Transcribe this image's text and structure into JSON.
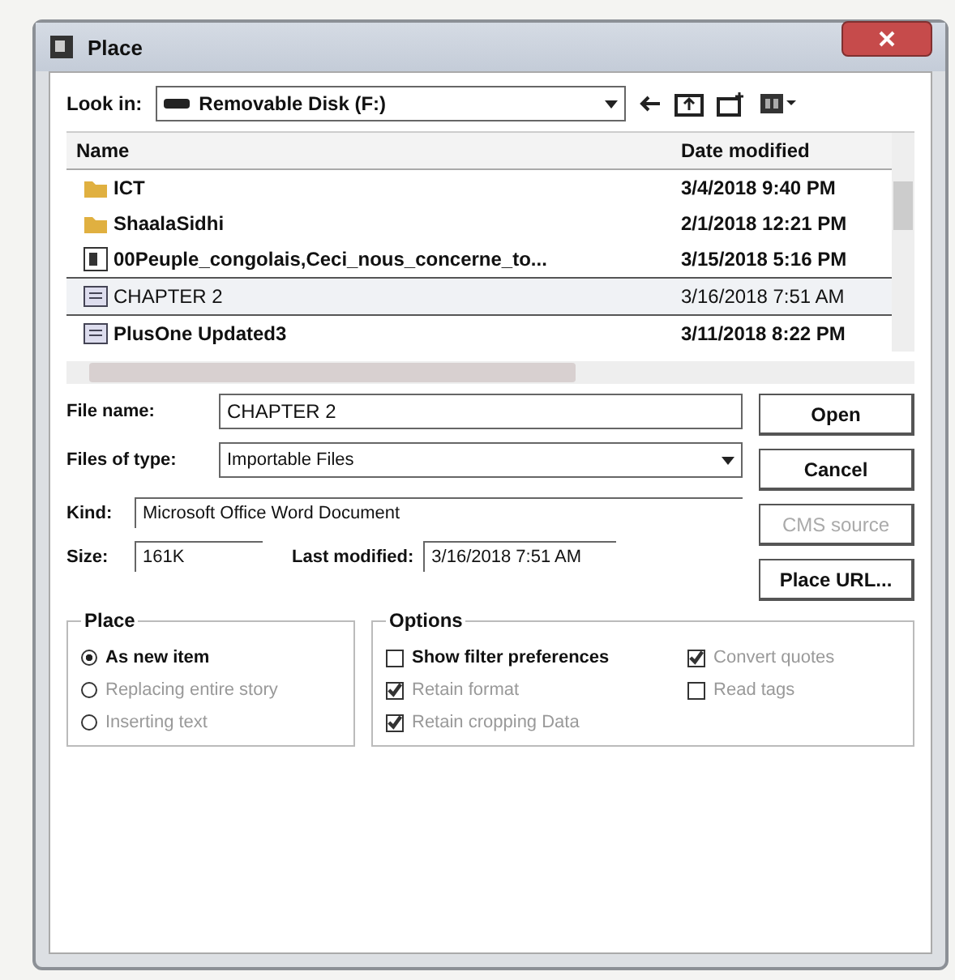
{
  "window": {
    "title": "Place"
  },
  "look_in": {
    "label": "Look in:",
    "value": "Removable Disk (F:)"
  },
  "file_list": {
    "columns": [
      "Name",
      "Date modified"
    ],
    "rows": [
      {
        "kind": "folder",
        "name": "ICT",
        "date": "3/4/2018 9:40 PM",
        "selected": false
      },
      {
        "kind": "folder",
        "name": "ShaalaSidhi",
        "date": "2/1/2018 12:21 PM",
        "selected": false
      },
      {
        "kind": "media",
        "name": "00Peuple_congolais,Ceci_nous_concerne_to...",
        "date": "3/15/2018 5:16 PM",
        "selected": false
      },
      {
        "kind": "document",
        "name": "CHAPTER 2",
        "date": "3/16/2018 7:51 AM",
        "selected": true
      },
      {
        "kind": "document",
        "name": "PlusOne Updated3",
        "date": "3/11/2018 8:22 PM",
        "selected": false
      }
    ]
  },
  "file_name": {
    "label": "File name:",
    "value": "CHAPTER 2"
  },
  "files_of_type": {
    "label": "Files of type:",
    "value": "Importable Files"
  },
  "kind": {
    "label": "Kind:",
    "value": "Microsoft Office Word Document"
  },
  "size": {
    "label": "Size:",
    "value": "161K"
  },
  "last_modified": {
    "label": "Last modified:",
    "value": "3/16/2018 7:51 AM"
  },
  "buttons": [
    {
      "label": "Open",
      "disabled": false
    },
    {
      "label": "Cancel",
      "disabled": false
    },
    {
      "label": "CMS source",
      "disabled": true
    },
    {
      "label": "Place URL...",
      "disabled": false
    }
  ],
  "place": {
    "title": "Place",
    "options": [
      {
        "label": "As new item",
        "selected": true,
        "disabled": false
      },
      {
        "label": "Replacing entire story",
        "selected": false,
        "disabled": true
      },
      {
        "label": "Inserting text",
        "selected": false,
        "disabled": true
      }
    ]
  },
  "options": {
    "title": "Options",
    "items": [
      {
        "label": "Show filter preferences",
        "checked": false,
        "disabled": false
      },
      {
        "label": "Convert quotes",
        "checked": true,
        "disabled": true
      },
      {
        "label": "Retain format",
        "checked": true,
        "disabled": true
      },
      {
        "label": "Read tags",
        "checked": false,
        "disabled": true
      },
      {
        "label": "Retain cropping Data",
        "checked": true,
        "disabled": true
      }
    ]
  }
}
